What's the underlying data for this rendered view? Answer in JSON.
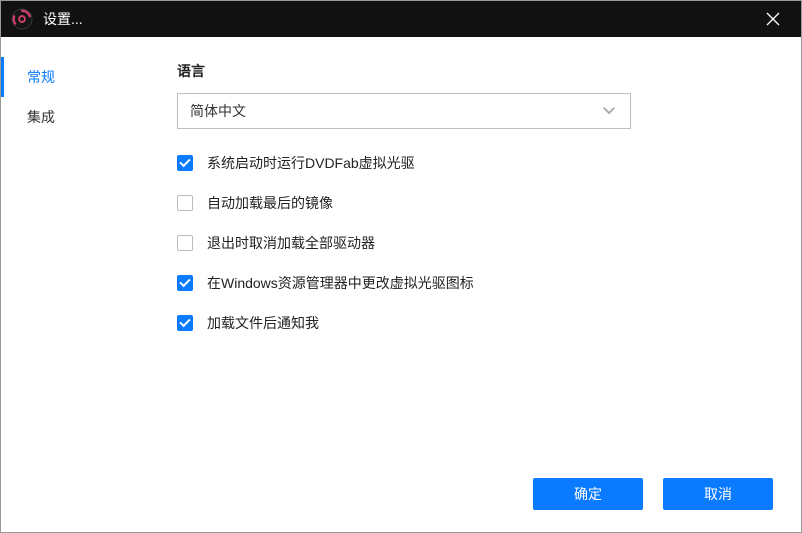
{
  "titlebar": {
    "title": "设置..."
  },
  "sidebar": {
    "items": [
      {
        "label": "常规",
        "active": true
      },
      {
        "label": "集成",
        "active": false
      }
    ]
  },
  "main": {
    "language_section_label": "语言",
    "language_select_value": "简体中文",
    "options": [
      {
        "label": "系统启动时运行DVDFab虚拟光驱",
        "checked": true
      },
      {
        "label": "自动加载最后的镜像",
        "checked": false
      },
      {
        "label": "退出时取消加载全部驱动器",
        "checked": false
      },
      {
        "label": "在Windows资源管理器中更改虚拟光驱图标",
        "checked": true
      },
      {
        "label": "加载文件后通知我",
        "checked": true
      }
    ]
  },
  "footer": {
    "ok_label": "确定",
    "cancel_label": "取消"
  },
  "colors": {
    "accent": "#0a7bff",
    "titlebar_bg": "#111111"
  }
}
